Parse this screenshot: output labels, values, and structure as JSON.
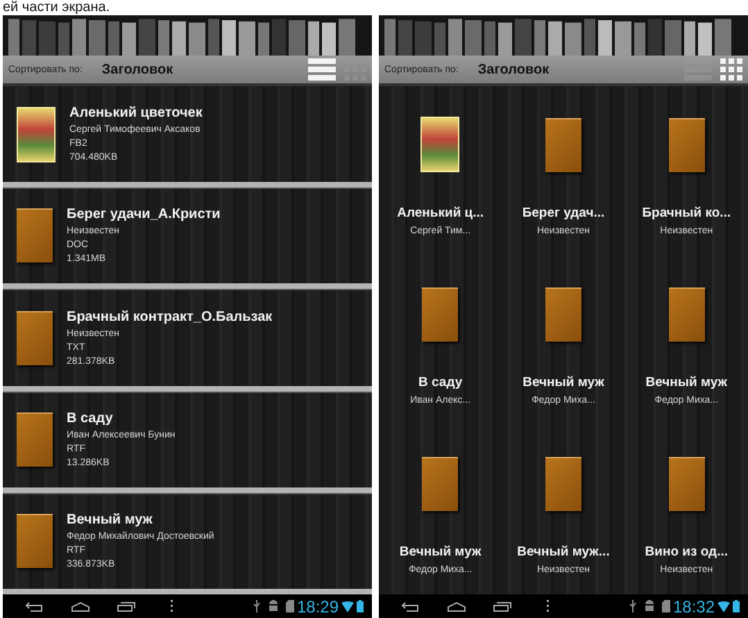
{
  "caption": "ей части экрана.",
  "screens": [
    {
      "kind": "list",
      "sort_label": "Сортировать по:",
      "sort_value": "Заголовок",
      "view_buttons": [
        {
          "kind": "list",
          "selected": true
        },
        {
          "kind": "grid",
          "selected": false
        }
      ],
      "books": [
        {
          "title": "Аленький цветочек",
          "author": "Сергей Тимофеевич Аксаков",
          "format": "FB2",
          "size": "704.480KB",
          "kind": "illustrated"
        },
        {
          "title": "Берег удачи_А.Кристи",
          "author": "Неизвестен",
          "format": "DOC",
          "size": "1.341MB",
          "kind": "plain"
        },
        {
          "title": "Брачный контракт_О.Бальзак",
          "author": "Неизвестен",
          "format": "TXT",
          "size": "281.378KB",
          "kind": "plain"
        },
        {
          "title": "В саду",
          "author": "Иван Алексеевич Бунин",
          "format": "RTF",
          "size": "13.286KB",
          "kind": "plain"
        },
        {
          "title": "Вечный муж",
          "author": "Федор Михайлович Достоевский",
          "format": "RTF",
          "size": "336.873KB",
          "kind": "plain"
        }
      ],
      "time": "18:29"
    },
    {
      "kind": "grid",
      "sort_label": "Сортировать по:",
      "sort_value": "Заголовок",
      "view_buttons": [
        {
          "kind": "list",
          "selected": false
        },
        {
          "kind": "grid",
          "selected": true
        }
      ],
      "books": [
        {
          "title": "Аленький ц...",
          "author": "Сергей Тим...",
          "kind": "illustrated"
        },
        {
          "title": "Берег удач...",
          "author": "Неизвестен",
          "kind": "plain"
        },
        {
          "title": "Брачный ко...",
          "author": "Неизвестен",
          "kind": "plain"
        },
        {
          "title": "В саду",
          "author": "Иван Алекс...",
          "kind": "plain"
        },
        {
          "title": "Вечный муж",
          "author": "Федор Миха...",
          "kind": "plain"
        },
        {
          "title": "Вечный муж",
          "author": "Федор Миха...",
          "kind": "plain"
        },
        {
          "title": "Вечный муж",
          "author": "Федор Миха...",
          "kind": "plain"
        },
        {
          "title": "Вечный муж...",
          "author": "Неизвестен",
          "kind": "plain"
        },
        {
          "title": "Вино из од...",
          "author": "Неизвестен",
          "kind": "plain"
        }
      ],
      "time": "18:32"
    }
  ]
}
